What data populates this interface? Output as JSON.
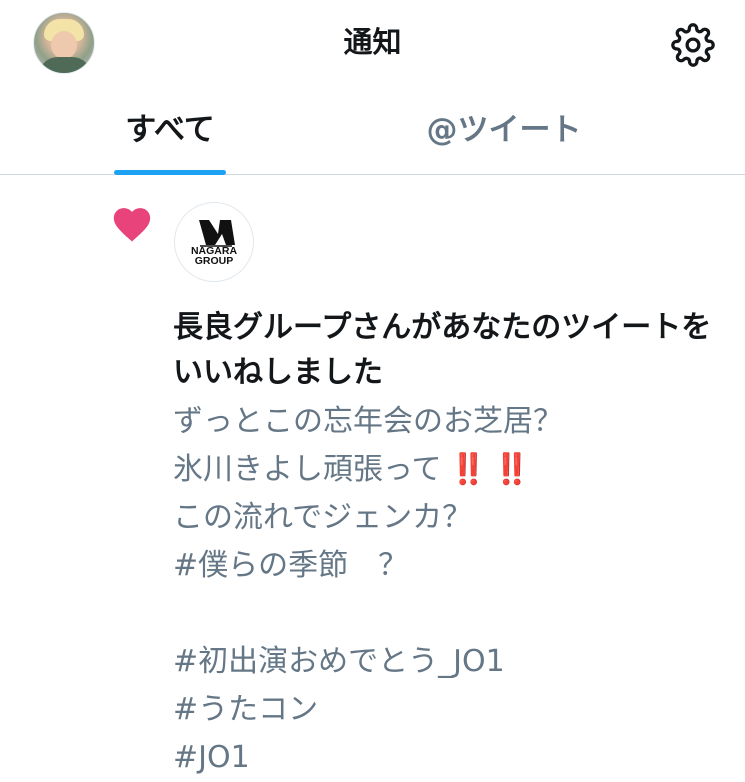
{
  "header": {
    "title": "通知",
    "avatar_icon": "avatar-icon",
    "settings_icon": "gear-icon"
  },
  "tabs": [
    {
      "label": "すべて",
      "active": true
    },
    {
      "label": "@ツイート",
      "active": false
    }
  ],
  "notification": {
    "type_icon": "heart-icon",
    "logo_text_line1": "NAGARA",
    "logo_text_line2": "GROUP",
    "headline": "長良グループさんがあなたのツイートをいいねしました",
    "tweet_lines": [
      "ずっとこの忘年会のお芝居？",
      "氷川きよし頑張って",
      "この流れでジェンカ？",
      "#僕らの季節　？",
      "",
      "#初出演おめでとう_JO1",
      "#うたコン",
      "#JO1"
    ],
    "emoji": "‼️ ‼️"
  },
  "colors": {
    "accent": "#1da1f2",
    "heart": "#e8437a",
    "text_primary": "#14171a",
    "text_secondary": "#657786",
    "emoji_red": "#e0245e"
  }
}
